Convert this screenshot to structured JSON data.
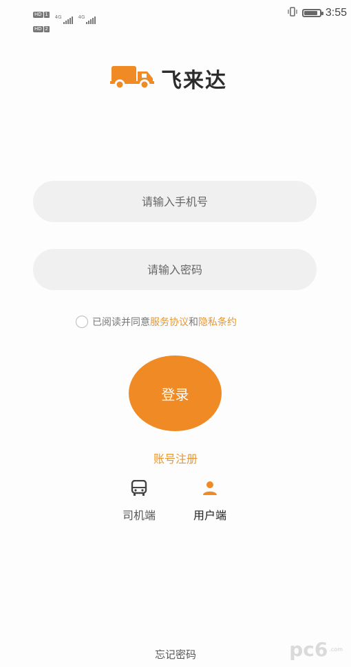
{
  "status_bar": {
    "hd_label": "HD",
    "sim1": "1",
    "sim2": "2",
    "network1": "4G",
    "network2": "4G",
    "time": "3:55",
    "battery_level": 0.9,
    "vibrate_icon": "vibrate-icon"
  },
  "app": {
    "name": "飞来达",
    "logo_icon": "delivery-truck-icon",
    "brand_color": "#f08a24",
    "link_color": "#e8962f"
  },
  "form": {
    "phone_placeholder": "请输入手机号",
    "password_placeholder": "请输入密码",
    "agreement_prefix": "已阅读并同意",
    "service_link": "服务协议",
    "agreement_and": "和",
    "privacy_link": "隐私条约",
    "login_label": "登录",
    "register_label": "账号注册",
    "forgot_label": "忘记密码"
  },
  "roles": [
    {
      "label": "司机端",
      "icon": "bus-icon",
      "selected": false
    },
    {
      "label": "用户端",
      "icon": "user-icon",
      "selected": true
    }
  ],
  "watermark": {
    "text": "pc6",
    "sub": ".com"
  }
}
